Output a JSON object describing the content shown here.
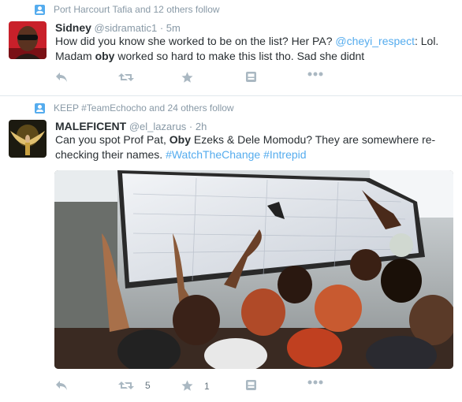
{
  "tweets": [
    {
      "context": "Port Harcourt Tafia and 12 others follow",
      "name": "Sidney",
      "handle": "@sidramatic1",
      "sep": "·",
      "time": "5m",
      "text_line1_a": "How did you know she worked to be on the list? Her PA? ",
      "mention": "@cheyi_respect",
      "text_line1_b": ": Lol.",
      "text_line2_a": "Madam ",
      "bold_word": "oby",
      "text_line2_b": " worked so hard to make this list tho. Sad she didnt",
      "retweet_count": "",
      "favorite_count": ""
    },
    {
      "context": "KEEP #TeamEchocho and 24 others follow",
      "name": "MALEFICENT",
      "handle": "@el_lazarus",
      "sep": "·",
      "time": "2h",
      "text_line1_a": "Can you spot Prof Pat, ",
      "bold_word": "Oby",
      "text_line1_b": " Ezeks & Dele Momodu? They are somewhere re-",
      "text_line2_a": "checking their names. ",
      "hashtag1": "#WatchTheChange",
      "hashtag2": "#Intrepid",
      "retweet_count": "5",
      "favorite_count": "1"
    }
  ],
  "icons": {
    "follow_context": "person-icon",
    "reply": "reply-icon",
    "retweet": "retweet-icon",
    "favorite": "star-icon",
    "add_to_collection": "collection-icon",
    "more": "more-icon"
  },
  "colors": {
    "link": "#55acee",
    "muted": "#8899a6",
    "icon": "#aab8c2",
    "text": "#292f33"
  }
}
